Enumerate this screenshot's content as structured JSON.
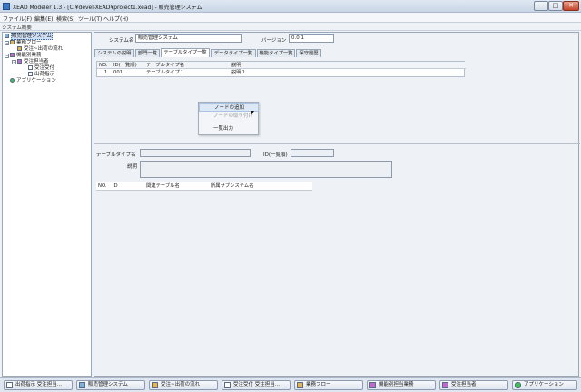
{
  "window": {
    "title": "XEAD Modeler 1.3 - [C:¥devel-XEAD¥project1.xead] - 販売管理システム",
    "min_glyph": "─",
    "max_glyph": "□",
    "close_glyph": "✕"
  },
  "menubar": {
    "items": [
      "ファイル(F)",
      "編集(E)",
      "検索(S)",
      "ツール(T)",
      "ヘルプ(H)"
    ]
  },
  "toolbar": {
    "label": "システム概要"
  },
  "tree": {
    "items": [
      {
        "label": "販売管理システム",
        "icon": "system-icon"
      },
      {
        "label": "業務フロー",
        "icon": "flow-icon"
      },
      {
        "label": "受注~出荷の流れ",
        "icon": "flow-icon"
      },
      {
        "label": "機能別業務",
        "icon": "process-icon"
      },
      {
        "label": "受注担当者",
        "icon": "process-icon"
      },
      {
        "label": "受注受付",
        "icon": "document-icon"
      },
      {
        "label": "出荷指示",
        "icon": "document-icon"
      },
      {
        "label": "アプリケーション",
        "icon": "application-icon"
      }
    ]
  },
  "main": {
    "system_name_label": "システム名",
    "system_name_value": "販売管理システム",
    "version_label": "バージョン",
    "version_value": "0.0.1",
    "tabs": [
      "システムの説明",
      "部門一覧",
      "テーブルタイプ一覧",
      "データタイプ一覧",
      "機能タイプ一覧",
      "保守履歴"
    ],
    "active_tab": 2,
    "grid": {
      "columns": [
        "NO.",
        "ID(一覧順)",
        "テーブルタイプ名",
        "説明"
      ],
      "rows": [
        [
          "1",
          "001",
          "テーブルタイプ１",
          "説明１"
        ]
      ]
    },
    "context_menu": {
      "items": [
        {
          "label": "ノードの追加",
          "state": "highlighted"
        },
        {
          "label": "ノードの取り付け",
          "state": "disabled"
        },
        {
          "label": "一覧出力",
          "state": "normal"
        }
      ]
    },
    "detail": {
      "table_type_label": "テーブルタイプ名",
      "id_label": "ID(一覧順)",
      "description_label": "説明"
    },
    "lower_grid": {
      "columns": [
        "NO.",
        "ID",
        "関連テーブル名",
        "所属サブシステム名"
      ]
    }
  },
  "taskbar": {
    "items": [
      {
        "label": "出荷指示 受注担当...",
        "icon": "document-icon"
      },
      {
        "label": "販売管理システム",
        "icon": "system-icon"
      },
      {
        "label": "受注~出荷の流れ",
        "icon": "flow-icon"
      },
      {
        "label": "受注受付 受注担当...",
        "icon": "document-icon"
      },
      {
        "label": "業務フロー",
        "icon": "flow-icon"
      },
      {
        "label": "機能別担当業務",
        "icon": "process-icon"
      },
      {
        "label": "受注担当者",
        "icon": "process-icon"
      },
      {
        "label": "アプリケーション",
        "icon": "application-icon"
      }
    ]
  }
}
